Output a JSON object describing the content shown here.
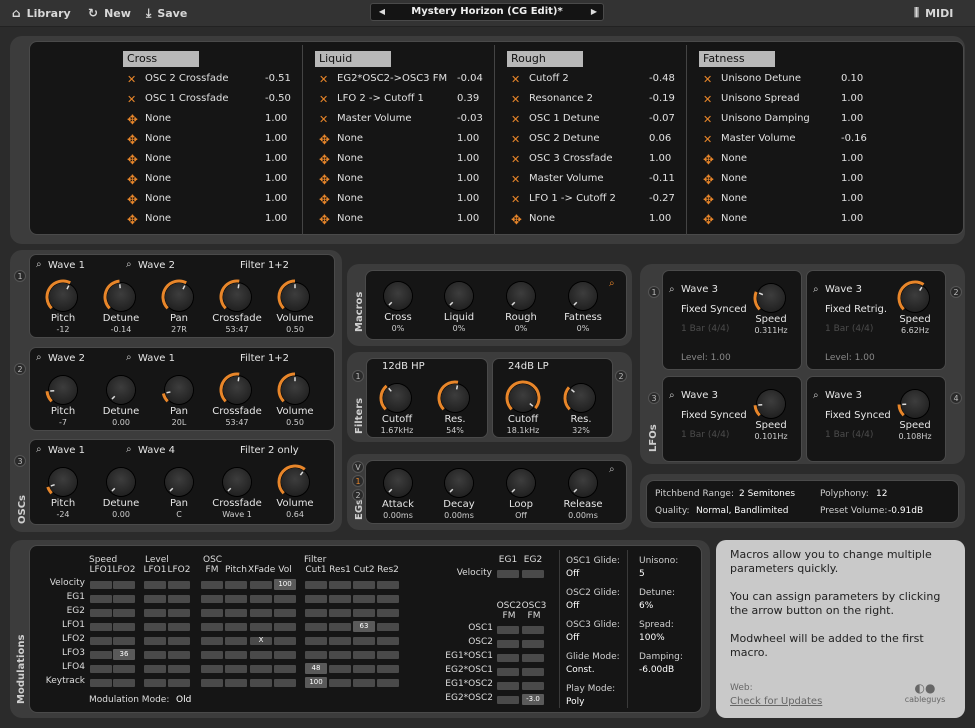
{
  "toolbar": {
    "library": "Library",
    "new": "New",
    "save": "Save",
    "midi": "MIDI"
  },
  "preset": {
    "name": "Mystery Horizon (CG Edit)*"
  },
  "macros_matrix": {
    "columns": [
      {
        "title": "Cross",
        "rows": [
          {
            "icon": "x",
            "target": "OSC 2 Crossfade",
            "value": "-0.51"
          },
          {
            "icon": "x",
            "target": "OSC 1 Crossfade",
            "value": "-0.50"
          },
          {
            "icon": "arrows",
            "target": "None",
            "value": "1.00"
          },
          {
            "icon": "arrows",
            "target": "None",
            "value": "1.00"
          },
          {
            "icon": "arrows",
            "target": "None",
            "value": "1.00"
          },
          {
            "icon": "arrows",
            "target": "None",
            "value": "1.00"
          },
          {
            "icon": "arrows",
            "target": "None",
            "value": "1.00"
          },
          {
            "icon": "arrows",
            "target": "None",
            "value": "1.00"
          }
        ]
      },
      {
        "title": "Liquid",
        "rows": [
          {
            "icon": "x",
            "target": "EG2*OSC2->OSC3 FM",
            "value": "-0.04"
          },
          {
            "icon": "x",
            "target": "LFO 2 -> Cutoff 1",
            "value": "0.39"
          },
          {
            "icon": "x",
            "target": "Master Volume",
            "value": "-0.03"
          },
          {
            "icon": "arrows",
            "target": "None",
            "value": "1.00"
          },
          {
            "icon": "arrows",
            "target": "None",
            "value": "1.00"
          },
          {
            "icon": "arrows",
            "target": "None",
            "value": "1.00"
          },
          {
            "icon": "arrows",
            "target": "None",
            "value": "1.00"
          },
          {
            "icon": "arrows",
            "target": "None",
            "value": "1.00"
          }
        ]
      },
      {
        "title": "Rough",
        "rows": [
          {
            "icon": "x",
            "target": "Cutoff 2",
            "value": "-0.48"
          },
          {
            "icon": "x",
            "target": "Resonance 2",
            "value": "-0.19"
          },
          {
            "icon": "x",
            "target": "OSC 1 Detune",
            "value": "-0.07"
          },
          {
            "icon": "x",
            "target": "OSC 2 Detune",
            "value": "0.06"
          },
          {
            "icon": "x",
            "target": "OSC 3 Crossfade",
            "value": "1.00"
          },
          {
            "icon": "x",
            "target": "Master Volume",
            "value": "-0.11"
          },
          {
            "icon": "x",
            "target": "LFO 1 -> Cutoff 2",
            "value": "-0.27"
          },
          {
            "icon": "arrows",
            "target": "None",
            "value": "1.00"
          }
        ]
      },
      {
        "title": "Fatness",
        "rows": [
          {
            "icon": "x",
            "target": "Unisono Detune",
            "value": "0.10"
          },
          {
            "icon": "x",
            "target": "Unisono Spread",
            "value": "1.00"
          },
          {
            "icon": "x",
            "target": "Unisono Damping",
            "value": "1.00"
          },
          {
            "icon": "x",
            "target": "Master Volume",
            "value": "-0.16"
          },
          {
            "icon": "arrows",
            "target": "None",
            "value": "1.00"
          },
          {
            "icon": "arrows",
            "target": "None",
            "value": "1.00"
          },
          {
            "icon": "arrows",
            "target": "None",
            "value": "1.00"
          },
          {
            "icon": "arrows",
            "target": "None",
            "value": "1.00"
          }
        ]
      }
    ]
  },
  "oscs": {
    "side_label": "OSCs",
    "items": [
      {
        "num": "1",
        "wave_a": "Wave 1",
        "wave_b": "Wave 2",
        "filter": "Filter 1+2",
        "knobs": [
          {
            "label": "Pitch",
            "value": "-12",
            "level": 0.6
          },
          {
            "label": "Detune",
            "value": "-0.14",
            "level": 0.48
          },
          {
            "label": "Pan",
            "value": "27R",
            "level": 0.6
          },
          {
            "label": "Crossfade",
            "value": "53:47",
            "level": 0.53
          },
          {
            "label": "Volume",
            "value": "0.50",
            "level": 0.5
          }
        ]
      },
      {
        "num": "2",
        "wave_a": "Wave 2",
        "wave_b": "Wave 1",
        "filter": "Filter 1+2",
        "knobs": [
          {
            "label": "Pitch",
            "value": "-7",
            "level": 0.15
          },
          {
            "label": "Detune",
            "value": "0.00",
            "level": 0.0
          },
          {
            "label": "Pan",
            "value": "20L",
            "level": 0.12
          },
          {
            "label": "Crossfade",
            "value": "53:47",
            "level": 0.53
          },
          {
            "label": "Volume",
            "value": "0.50",
            "level": 0.5
          }
        ]
      },
      {
        "num": "3",
        "wave_a": "Wave 1",
        "wave_b": "Wave 4",
        "filter": "Filter 2 only",
        "knobs": [
          {
            "label": "Pitch",
            "value": "-24",
            "level": 0.1
          },
          {
            "label": "Detune",
            "value": "0.00",
            "level": 0.0
          },
          {
            "label": "Pan",
            "value": "C",
            "level": 0.0
          },
          {
            "label": "Crossfade",
            "value": "Wave 1",
            "level": 0.0
          },
          {
            "label": "Volume",
            "value": "0.64",
            "level": 0.64
          }
        ]
      }
    ]
  },
  "macros": {
    "side_label": "Macros",
    "knobs": [
      {
        "label": "Cross",
        "value": "0%"
      },
      {
        "label": "Liquid",
        "value": "0%"
      },
      {
        "label": "Rough",
        "value": "0%"
      },
      {
        "label": "Fatness",
        "value": "0%"
      }
    ]
  },
  "filters": {
    "side_label": "Filters",
    "items": [
      {
        "num": "1",
        "type": "12dB HP",
        "knobs": [
          {
            "label": "Cutoff",
            "value": "1.67kHz",
            "level": 0.35
          },
          {
            "label": "Res.",
            "value": "54%",
            "level": 0.54
          }
        ]
      },
      {
        "num": "2",
        "type": "24dB LP",
        "knobs": [
          {
            "label": "Cutoff",
            "value": "18.1kHz",
            "level": 0.98
          },
          {
            "label": "Res.",
            "value": "32%",
            "level": 0.32
          }
        ]
      }
    ]
  },
  "egs": {
    "side_label": "EGs",
    "tabs": [
      "V",
      "1",
      "2"
    ],
    "knobs": [
      {
        "label": "Attack",
        "value": "0.00ms",
        "level": 0.0
      },
      {
        "label": "Decay",
        "value": "0.00ms",
        "level": 0.0
      },
      {
        "label": "Loop",
        "value": "Off",
        "level": 0.0
      },
      {
        "label": "Release",
        "value": "0.00ms",
        "level": 0.0
      }
    ]
  },
  "lfos": {
    "side_label": "LFOs",
    "items": [
      {
        "num": "1",
        "wave": "Wave 3",
        "mode": "Fixed Synced",
        "rate_note": "1 Bar (4/4)",
        "level": "Level:  1.00",
        "speed_label": "Speed",
        "speed": "0.311Hz",
        "lvl": 0.25
      },
      {
        "num": "2",
        "wave": "Wave 3",
        "mode": "Fixed Retrig.",
        "rate_note": "1 Bar (4/4)",
        "level": "Level:  1.00",
        "speed_label": "Speed",
        "speed": "6.62Hz",
        "lvl": 0.62
      },
      {
        "num": "3",
        "wave": "Wave 3",
        "mode": "Fixed Synced",
        "rate_note": "1 Bar (4/4)",
        "level": "",
        "speed_label": "Speed",
        "speed": "0.101Hz",
        "lvl": 0.15
      },
      {
        "num": "4",
        "wave": "Wave 3",
        "mode": "Fixed Synced",
        "rate_note": "1 Bar (4/4)",
        "level": "",
        "speed_label": "Speed",
        "speed": "0.108Hz",
        "lvl": 0.16
      }
    ]
  },
  "global": {
    "pitchbend_label": "Pitchbend Range:",
    "pitchbend": "2 Semitones",
    "polyphony_label": "Polyphony:",
    "polyphony": "12",
    "quality_label": "Quality:",
    "quality": "Normal, Bandlimited",
    "preset_volume_label": "Preset Volume:",
    "preset_volume": "-0.91dB"
  },
  "modulations": {
    "side_label": "Modulations",
    "group_heads": [
      "Speed",
      "Level",
      "OSC",
      "Filter"
    ],
    "col_heads": [
      "LFO1",
      "LFO2",
      "LFO1",
      "LFO2",
      "FM",
      "Pitch",
      "XFade",
      "Vol",
      "Cut1",
      "Res1",
      "Cut2",
      "Res2"
    ],
    "sources": [
      "Velocity",
      "EG1",
      "EG2",
      "LFO1",
      "LFO2",
      "LFO3",
      "LFO4",
      "Keytrack"
    ],
    "values": {
      "vel_vol": "100",
      "lfo1_cut2": "63",
      "lfo2_xfade": "X",
      "lfo3_speed2": "36",
      "lfo4_cut1": "48",
      "kt_cut1": "100"
    },
    "mode_label": "Modulation Mode:",
    "mode": "Old",
    "eg_heads": [
      "EG1",
      "EG2"
    ],
    "fm_heads": [
      "OSC2\nFM",
      "OSC3\nFM"
    ],
    "fm_sources": [
      "OSC1",
      "OSC2",
      "EG1*OSC1",
      "EG2*OSC1",
      "EG1*OSC2",
      "EG2*OSC2"
    ],
    "fm_val": "-3.0",
    "glides": [
      {
        "label": "OSC1 Glide:",
        "value": "Off"
      },
      {
        "label": "OSC2 Glide:",
        "value": "Off"
      },
      {
        "label": "OSC3 Glide:",
        "value": "Off"
      },
      {
        "label": "Glide Mode:",
        "value": "Const."
      },
      {
        "label": "Play Mode:",
        "value": "Poly"
      }
    ],
    "unisono": [
      {
        "label": "Unisono:",
        "value": "5"
      },
      {
        "label": "Detune:",
        "value": "6%"
      },
      {
        "label": "Spread:",
        "value": "100%"
      },
      {
        "label": "Damping:",
        "value": "-6.00dB"
      }
    ]
  },
  "help": {
    "p1": "Macros allow you to change multiple parameters quickly.",
    "p2": "You can assign parameters by clicking the arrow button on the right.",
    "p3": "Modwheel will be added to the first macro.",
    "web_label": "Web:",
    "link": "Check for Updates",
    "brand": "cableguys"
  },
  "colors": {
    "accent": "#e8862a"
  }
}
